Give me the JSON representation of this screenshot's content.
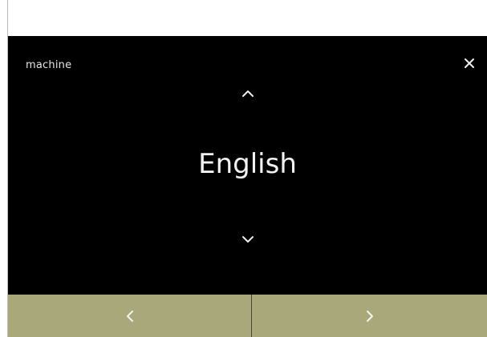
{
  "header": {
    "title": "machine"
  },
  "selector": {
    "current_value": "English"
  },
  "icons": {
    "close": "close-icon",
    "up": "chevron-up-icon",
    "down": "chevron-down-icon",
    "prev": "chevron-left-icon",
    "next": "chevron-right-icon"
  },
  "colors": {
    "screen_background": "#000000",
    "footer_background": "#a9a87a",
    "text": "#f2f2f2"
  }
}
